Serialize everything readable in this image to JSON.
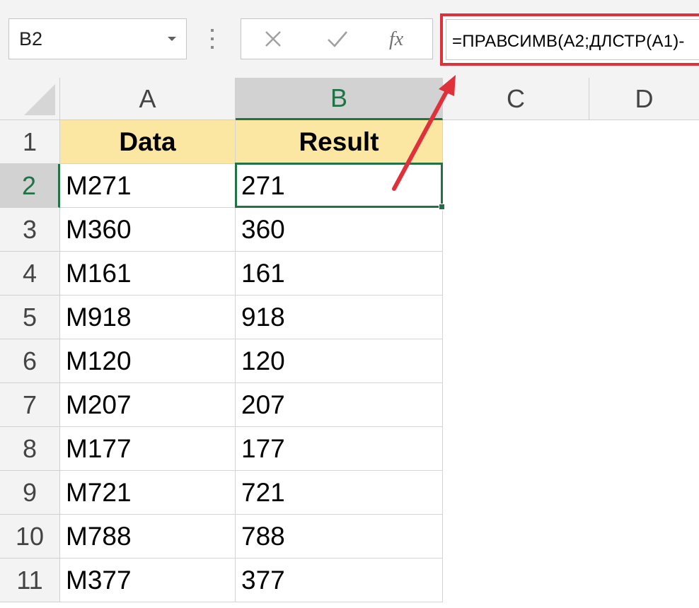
{
  "formula_bar": {
    "name_box": "B2",
    "formula": "=ПРАВСИМВ(A2;ДЛСТР(A1)-",
    "icons": [
      "cancel-x-icon",
      "check-enter-icon",
      "fx-insert-function-icon"
    ]
  },
  "sheet": {
    "columns": [
      "A",
      "B",
      "C",
      "D"
    ],
    "rows": [
      "1",
      "2",
      "3",
      "4",
      "5",
      "6",
      "7",
      "8",
      "9",
      "10",
      "11"
    ],
    "selected_cell": "B2",
    "header_row": {
      "a": "Data",
      "b": "Result"
    },
    "data": [
      {
        "a": "M271",
        "b": "271"
      },
      {
        "a": "M360",
        "b": "360"
      },
      {
        "a": "M161",
        "b": "161"
      },
      {
        "a": "M918",
        "b": "918"
      },
      {
        "a": "M120",
        "b": "120"
      },
      {
        "a": "M207",
        "b": "207"
      },
      {
        "a": "M177",
        "b": "177"
      },
      {
        "a": "M721",
        "b": "721"
      },
      {
        "a": "M788",
        "b": "788"
      },
      {
        "a": "M377",
        "b": "377"
      }
    ]
  },
  "colors": {
    "header_fill": "#fbe6a2",
    "selection_green": "#217346",
    "highlight_red": "#e0303a"
  }
}
